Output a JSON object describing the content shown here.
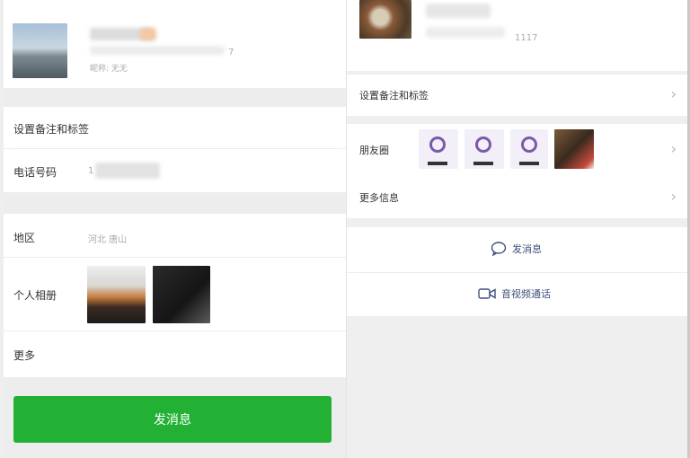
{
  "left": {
    "profile": {
      "nickname": "昵称: 无无",
      "suffix": "7"
    },
    "remark_label": "设置备注和标签",
    "phone": {
      "label": "电话号码",
      "value": "1"
    },
    "region": {
      "label": "地区",
      "value": "河北 唐山"
    },
    "album_label": "个人相册",
    "more_label": "更多",
    "send_message_button": "发消息"
  },
  "right": {
    "profile": {
      "id_suffix": "1117"
    },
    "remark_label": "设置备注和标签",
    "moments_label": "朋友圈",
    "more_info_label": "更多信息",
    "send_message": "发消息",
    "video_call": "音视频通话"
  },
  "colors": {
    "green": "#22b135",
    "link": "#3d4f7a"
  }
}
